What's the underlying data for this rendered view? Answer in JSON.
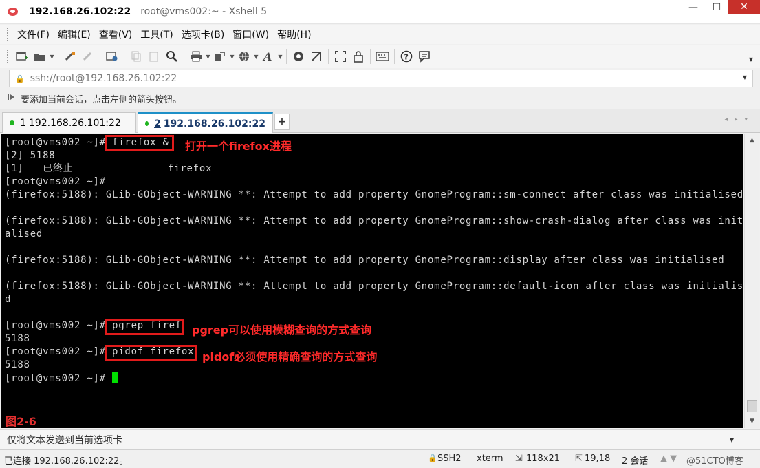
{
  "window": {
    "title_host": "192.168.26.102:22",
    "title_rest": "root@vms002:~ - Xshell 5",
    "minimize": "—",
    "maximize": "☐",
    "close": "✕"
  },
  "menu": [
    "文件(F)",
    "编辑(E)",
    "查看(V)",
    "工具(T)",
    "选项卡(B)",
    "窗口(W)",
    "帮助(H)"
  ],
  "address": {
    "lock": "🔒",
    "url": "ssh://root@192.168.26.102:22"
  },
  "hint": "要添加当前会话，点击左侧的箭头按钮。",
  "tabs": [
    {
      "num": "1",
      "label": "192.168.26.101:22"
    },
    {
      "num": "2",
      "label": "192.168.26.102:22"
    }
  ],
  "tab_add": "+",
  "terminal": {
    "prompt": "[root@vms002 ~]#",
    "lines": [
      " firefox &",
      "[2] 5188",
      "[1]   已终止               firefox",
      "[root@vms002 ~]#",
      "(firefox:5188): GLib-GObject-WARNING **: Attempt to add property GnomeProgram::sm-connect after class was initialised",
      "",
      "(firefox:5188): GLib-GObject-WARNING **: Attempt to add property GnomeProgram::show-crash-dialog after class was initi",
      "alised",
      "",
      "(firefox:5188): GLib-GObject-WARNING **: Attempt to add property GnomeProgram::display after class was initialised",
      "",
      "(firefox:5188): GLib-GObject-WARNING **: Attempt to add property GnomeProgram::default-icon after class was initialise",
      "d",
      "",
      " pgrep firef",
      "5188",
      " pidof firefox",
      "5188",
      ""
    ],
    "annotations": {
      "firefox": "打开一个firefox进程",
      "pgrep": "pgrep可以使用模糊查询的方式查询",
      "pidof": "pidof必须使用精确查询的方式查询"
    },
    "figure_label": "图2-6"
  },
  "send_bar": "仅将文本发送到当前选项卡",
  "status": {
    "connected": "已连接 192.168.26.102:22。",
    "protocol": "SSH2",
    "term": "xterm",
    "size": "118x21",
    "pos": "19,18",
    "sessions": "2 会话",
    "watermark": "@51CTO博客"
  }
}
